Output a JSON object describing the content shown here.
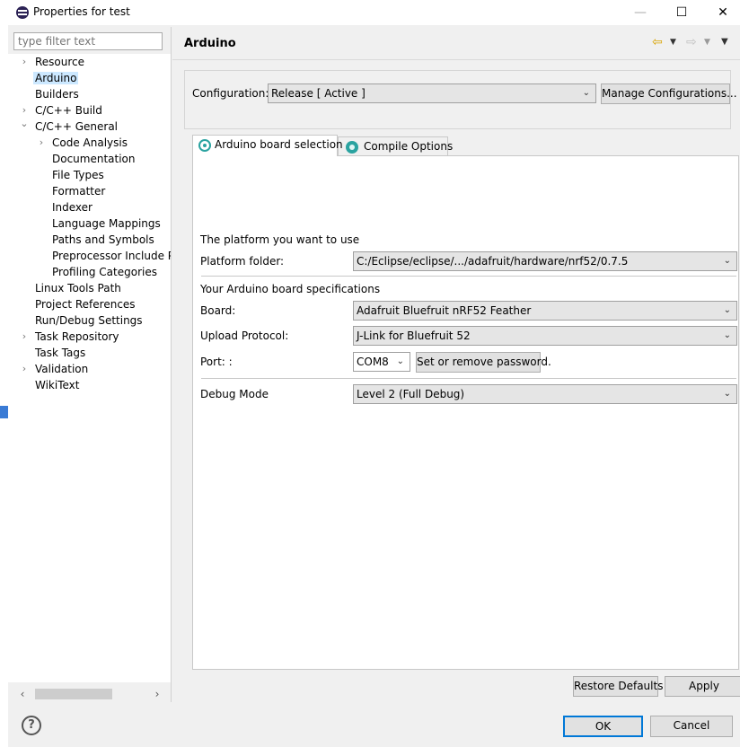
{
  "window": {
    "title": "Properties for test",
    "minimize_glyph": "—",
    "maximize_glyph": "☐",
    "close_glyph": "✕"
  },
  "filter": {
    "placeholder": "type filter text"
  },
  "tree": {
    "items": [
      {
        "label": "Resource",
        "twist": "›"
      },
      {
        "label": "Arduino",
        "twist": ""
      },
      {
        "label": "Builders",
        "twist": ""
      },
      {
        "label": "C/C++ Build",
        "twist": "›"
      },
      {
        "label": "C/C++ General",
        "twist": "⌄"
      },
      {
        "label": "Code Analysis",
        "twist": "›"
      },
      {
        "label": "Documentation",
        "twist": ""
      },
      {
        "label": "File Types",
        "twist": ""
      },
      {
        "label": "Formatter",
        "twist": ""
      },
      {
        "label": "Indexer",
        "twist": ""
      },
      {
        "label": "Language Mappings",
        "twist": ""
      },
      {
        "label": "Paths and Symbols",
        "twist": ""
      },
      {
        "label": "Preprocessor Include Pa",
        "twist": ""
      },
      {
        "label": "Profiling Categories",
        "twist": ""
      },
      {
        "label": "Linux Tools Path",
        "twist": ""
      },
      {
        "label": "Project References",
        "twist": ""
      },
      {
        "label": "Run/Debug Settings",
        "twist": ""
      },
      {
        "label": "Task Repository",
        "twist": "›"
      },
      {
        "label": "Task Tags",
        "twist": ""
      },
      {
        "label": "Validation",
        "twist": "›"
      },
      {
        "label": "WikiText",
        "twist": ""
      }
    ],
    "scroll_left": "‹",
    "scroll_right": "›"
  },
  "page": {
    "title": "Arduino",
    "back_glyph": "⇦",
    "forward_glyph": "⇨",
    "menu_glyph": "▼"
  },
  "configuration": {
    "label": "Configuration:",
    "value": "Release  [ Active ]",
    "manage_button": "Manage Configurations..."
  },
  "tabs": [
    {
      "label": "Arduino board selection"
    },
    {
      "label": "Compile Options"
    }
  ],
  "board": {
    "platform_heading": "The platform you want to use",
    "platform_folder_label": "Platform folder:",
    "platform_folder_value": "C:/Eclipse/eclipse/.../adafruit/hardware/nrf52/0.7.5",
    "specs_heading": "Your Arduino board specifications",
    "board_label": "Board:",
    "board_value": "Adafruit Bluefruit nRF52 Feather",
    "upload_label": "Upload Protocol:",
    "upload_value": "J-Link for Bluefruit 52",
    "port_label": "Port: :",
    "port_value": "COM8",
    "password_button": "Set or remove password.",
    "debug_label": "Debug Mode",
    "debug_value": "Level 2 (Full Debug)"
  },
  "buttons": {
    "restore_defaults": "Restore Defaults",
    "apply": "Apply",
    "ok": "OK",
    "cancel": "Cancel",
    "help": "?"
  },
  "chevron": "⌄"
}
